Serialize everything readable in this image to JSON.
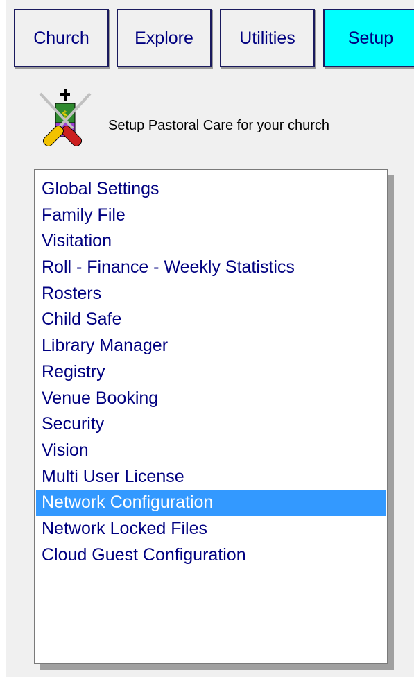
{
  "tabs": [
    {
      "label": "Church",
      "active": false
    },
    {
      "label": "Explore",
      "active": false
    },
    {
      "label": "Utilities",
      "active": false
    },
    {
      "label": "Setup",
      "active": true
    }
  ],
  "header": {
    "icon": "tools-screwdriver-icon",
    "text": "Setup Pastoral Care for your church"
  },
  "setup_list": {
    "items": [
      "Global Settings",
      "Family File",
      "Visitation",
      "Roll - Finance - Weekly Statistics",
      "Rosters",
      "Child Safe",
      "Library Manager",
      "Registry",
      "Venue Booking",
      "Security",
      "Vision",
      "Multi User License",
      "Network Configuration",
      "Network Locked Files",
      "Cloud Guest Configuration"
    ],
    "selected": "Network Configuration"
  },
  "colors": {
    "active_tab": "#00ffff",
    "selection": "#3399ff",
    "link_text": "#000080",
    "panel_bg": "#f0f0f0"
  }
}
